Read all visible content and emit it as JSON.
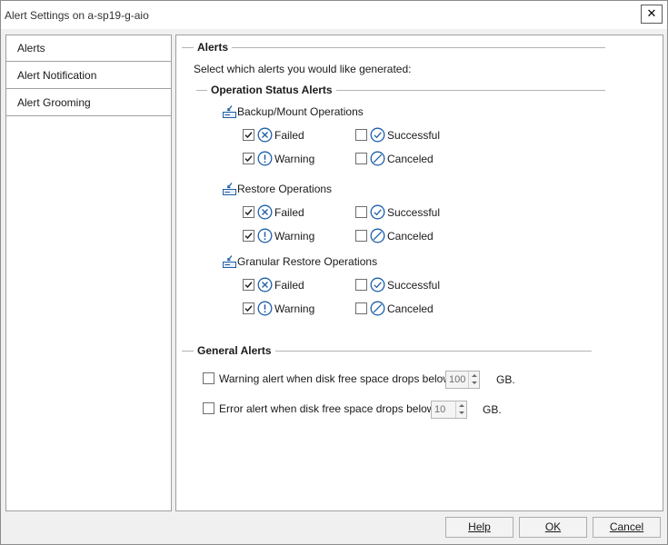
{
  "window": {
    "title": "Alert Settings on a-sp19-g-aio",
    "close_label": "✕"
  },
  "sidebar": {
    "items": [
      {
        "label": "Alerts"
      },
      {
        "label": "Alert  Notification"
      },
      {
        "label": "Alert Grooming"
      }
    ]
  },
  "alerts": {
    "title": "Alerts",
    "instruction": "Select which alerts you would like generated:",
    "operation_status": {
      "title": "Operation Status Alerts",
      "groups": [
        {
          "label": "Backup/Mount Operations",
          "options": {
            "failed": "Failed",
            "successful": "Successful",
            "warning": "Warning",
            "canceled": "Canceled"
          },
          "checked": {
            "failed": true,
            "successful": false,
            "warning": true,
            "canceled": false
          }
        },
        {
          "label": "Restore Operations",
          "options": {
            "failed": "Failed",
            "successful": "Successful",
            "warning": "Warning",
            "canceled": "Canceled"
          },
          "checked": {
            "failed": true,
            "successful": false,
            "warning": true,
            "canceled": false
          }
        },
        {
          "label": "Granular Restore Operations",
          "options": {
            "failed": "Failed",
            "successful": "Successful",
            "warning": "Warning",
            "canceled": "Canceled"
          },
          "checked": {
            "failed": true,
            "successful": false,
            "warning": true,
            "canceled": false
          }
        }
      ]
    },
    "general": {
      "title": "General Alerts",
      "warning_alert": {
        "label": "Warning alert when disk free space drops below",
        "value": "100",
        "unit": "GB.",
        "checked": false
      },
      "error_alert": {
        "label": "Error alert when disk free space drops below",
        "value": "10",
        "unit": "GB.",
        "checked": false
      }
    }
  },
  "buttons": {
    "help": {
      "label": "Help"
    },
    "ok": {
      "label": "OK"
    },
    "cancel": {
      "label": "Cancel"
    }
  },
  "icons": {
    "failed": "x-circle-icon",
    "successful": "check-circle-icon",
    "warning": "exclamation-circle-icon",
    "canceled": "slash-circle-icon",
    "operation": "server-arrow-icon"
  },
  "colors": {
    "icon_blue": "#1e5fa8",
    "check": "#222222"
  }
}
